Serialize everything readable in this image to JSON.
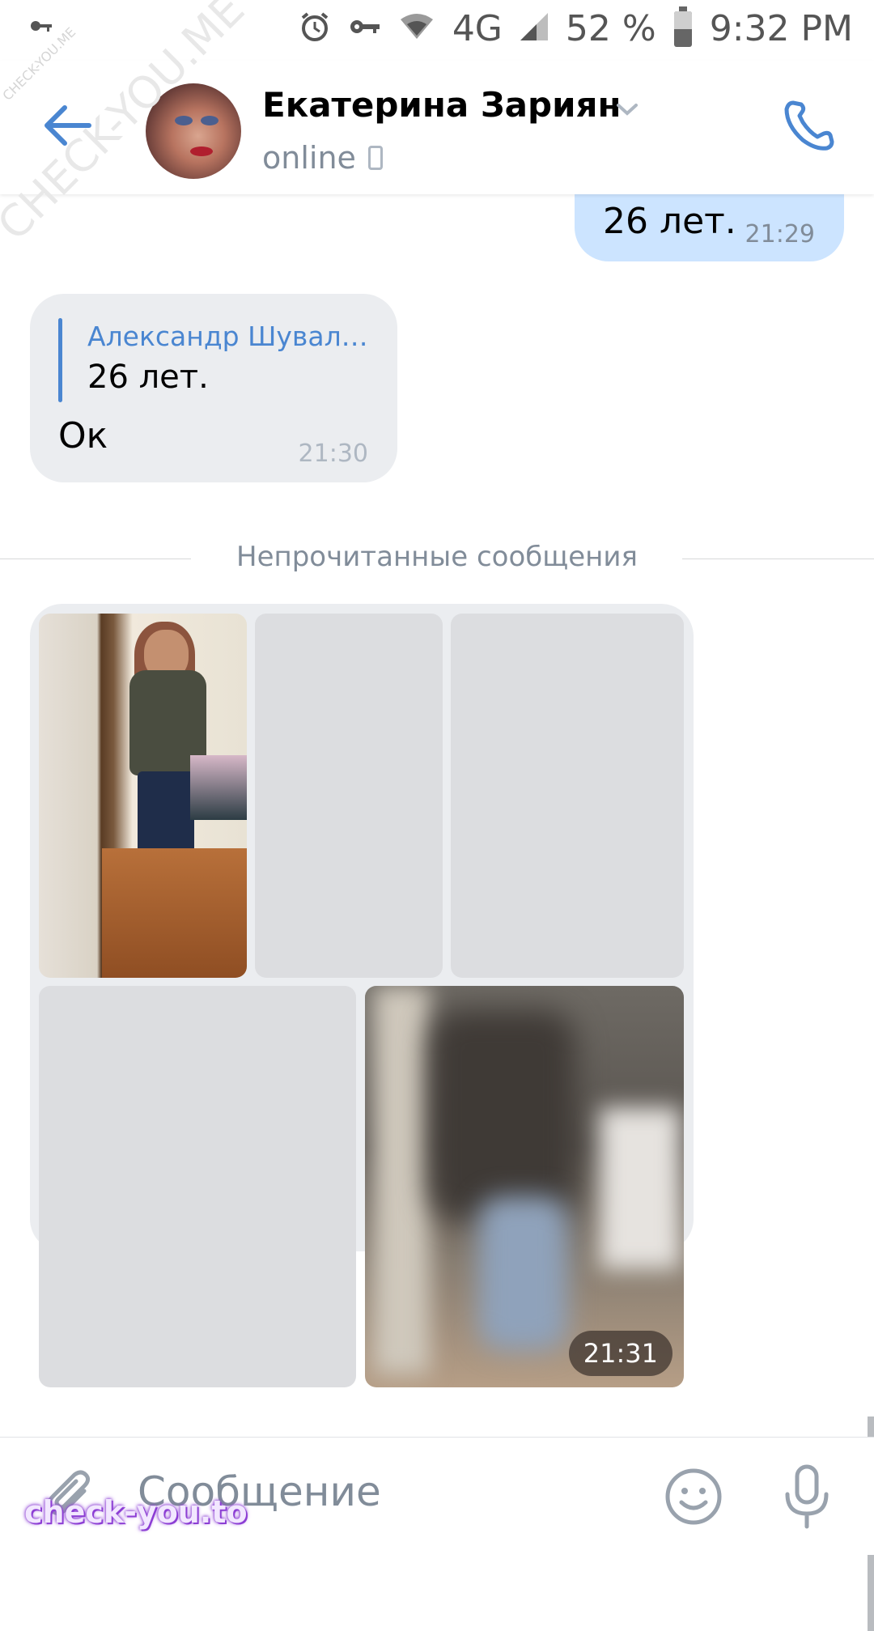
{
  "status_bar": {
    "signal_label": "4G",
    "battery": "52 %",
    "time": "9:32 PM"
  },
  "header": {
    "contact_name": "Екатерина Зариян",
    "status": "online"
  },
  "messages": {
    "outgoing_1": {
      "text": "26 лет.",
      "time": "21:29"
    },
    "incoming_1": {
      "reply_author": "Александр Шувал…",
      "reply_text": "26 лет.",
      "text": "Ок",
      "time": "21:30"
    },
    "unread_divider": "Непрочитанные сообщения",
    "album": {
      "time": "21:31"
    }
  },
  "composer": {
    "placeholder": "Сообщение"
  },
  "watermarks": {
    "top_small": "CHECK-YOU.ME",
    "top_large": "CHECK-YOU.ME",
    "bottom": "check-you.to"
  },
  "colors": {
    "accent": "#4a86d1",
    "outgoing_bubble": "#cce4ff",
    "incoming_bubble": "#ebedf0",
    "secondary_text": "#818c99"
  }
}
